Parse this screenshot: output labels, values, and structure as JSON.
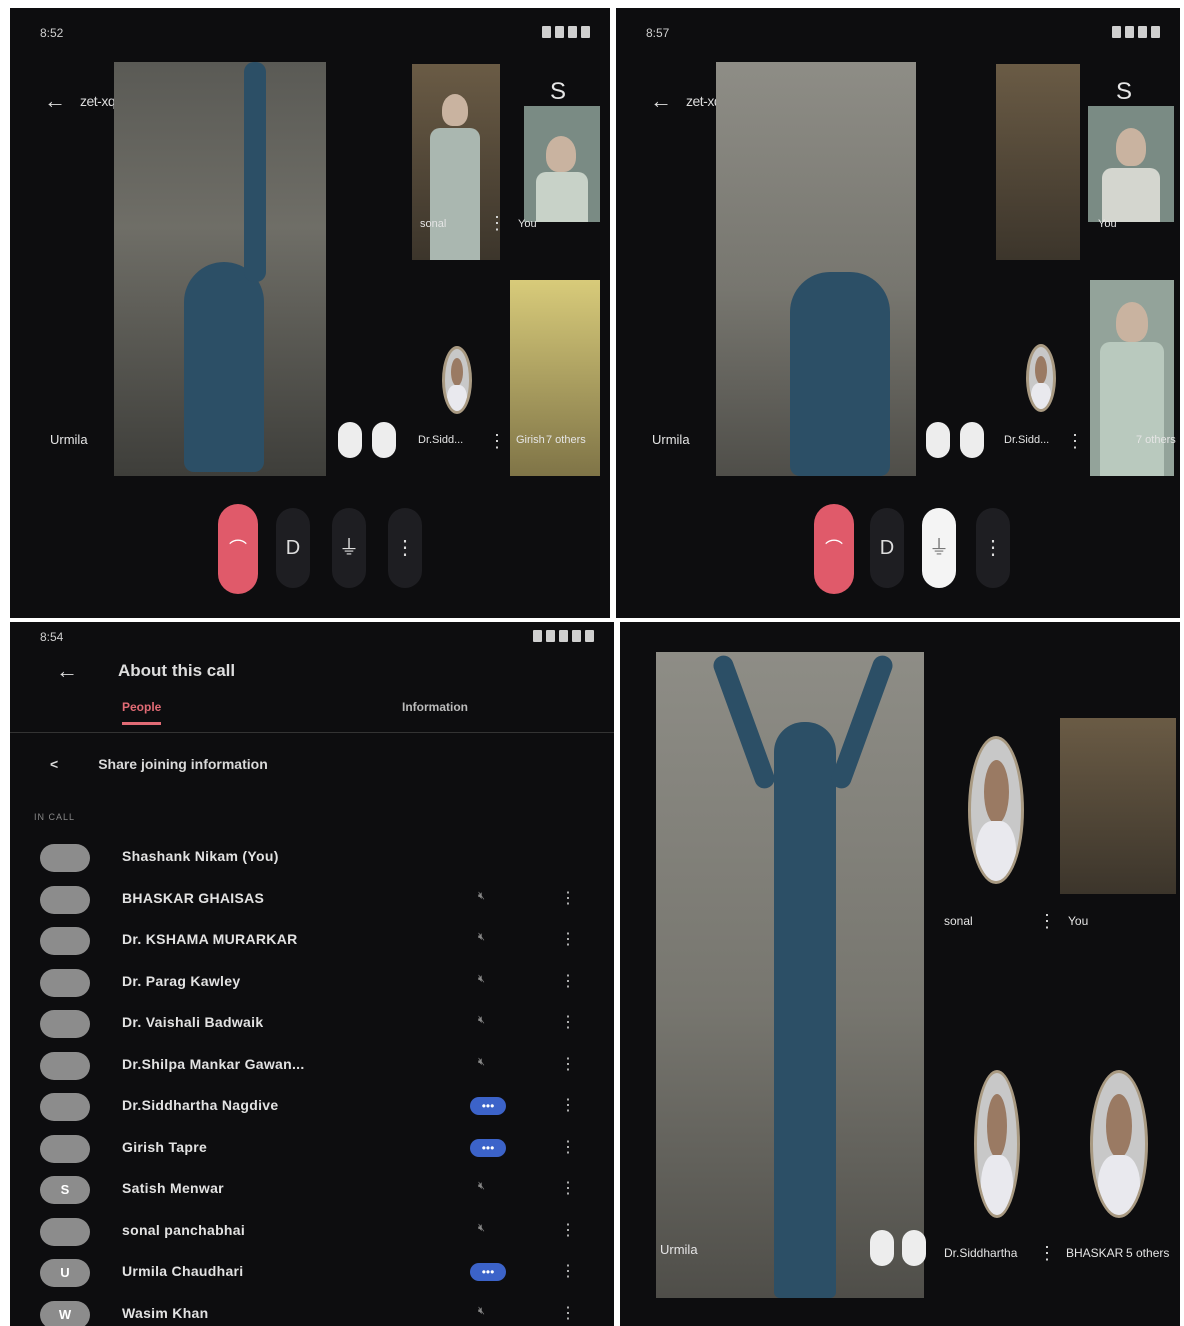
{
  "panel1": {
    "status_time": "8:52",
    "meeting_code": "zet-xqby-jsa",
    "main_label": "Urmila",
    "tiles": {
      "sonal": "sonal",
      "you": "You",
      "sidd": "Dr.Sidd...",
      "girish": "Girish",
      "others": "7 others"
    },
    "icons": {
      "end": "hang-up-icon",
      "cam": "camera-icon",
      "mic": "mic-icon",
      "more": "more-icon"
    }
  },
  "panel2": {
    "status_time": "8:57",
    "meeting_code": "zet-xqby-jsa",
    "main_label": "Urmila",
    "tiles": {
      "you": "You",
      "sidd": "Dr.Sidd...",
      "others": "7 others"
    }
  },
  "panel3": {
    "status_time": "8:54",
    "title": "About this call",
    "tab_people": "People",
    "tab_information": "Information",
    "share_label": "Share joining information",
    "section_label": "IN CALL",
    "participants": [
      {
        "name": "Shashank Nikam (You)",
        "avatar": "",
        "mic": ""
      },
      {
        "name": "BHASKAR GHAISAS",
        "avatar": "",
        "mic": "muted"
      },
      {
        "name": "Dr. KSHAMA MURARKAR",
        "avatar": "",
        "mic": "muted"
      },
      {
        "name": "Dr. Parag Kawley",
        "avatar": "",
        "mic": "muted"
      },
      {
        "name": "Dr. Vaishali Badwaik",
        "avatar": "",
        "mic": "muted"
      },
      {
        "name": "Dr.Shilpa Mankar Gawan...",
        "avatar": "",
        "mic": "muted"
      },
      {
        "name": "Dr.Siddhartha Nagdive",
        "avatar": "",
        "mic": "speaking"
      },
      {
        "name": "Girish Tapre",
        "avatar": "",
        "mic": "speaking"
      },
      {
        "name": "Satish Menwar",
        "avatar": "S",
        "mic": "muted"
      },
      {
        "name": "sonal panchabhai",
        "avatar": "",
        "mic": "muted"
      },
      {
        "name": "Urmila Chaudhari",
        "avatar": "U",
        "mic": "speaking"
      },
      {
        "name": "Wasim Khan",
        "avatar": "W",
        "mic": "muted"
      }
    ]
  },
  "panel4": {
    "main_label": "Urmila",
    "tiles": {
      "sonal": "sonal",
      "you": "You",
      "sidd": "Dr.Siddhartha",
      "bhaskar": "BHASKAR",
      "others": "5 others"
    }
  },
  "colors": {
    "bg": "#0d0d0f",
    "accent": "#e16b75",
    "end_call": "#e05a6a",
    "mic_active": "#3c63c9"
  }
}
